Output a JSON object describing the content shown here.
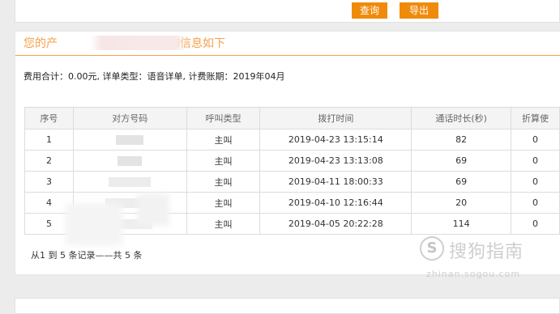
{
  "toolbar": {
    "query_label": "查询",
    "export_label": "导出"
  },
  "result": {
    "title_prefix": "您的产",
    "title_suffix": "询信息如下",
    "summary": "费用合计：0.00元, 详单类型：语音详单, 计费账期：2019年04月"
  },
  "table": {
    "columns": [
      "序号",
      "对方号码",
      "呼叫类型",
      "拨打时间",
      "通话时长(秒)",
      "折算使"
    ],
    "rows": [
      {
        "index": "1",
        "number": "",
        "type": "主叫",
        "time": "2019-04-23 13:15:14",
        "duration": "82",
        "converted": "0"
      },
      {
        "index": "2",
        "number": "",
        "type": "主叫",
        "time": "2019-04-23 13:13:08",
        "duration": "69",
        "converted": "0"
      },
      {
        "index": "3",
        "number": "",
        "type": "主叫",
        "time": "2019-04-11 18:00:33",
        "duration": "69",
        "converted": "0"
      },
      {
        "index": "4",
        "number": "",
        "type": "主叫",
        "time": "2019-04-10 12:16:44",
        "duration": "20",
        "converted": "0"
      },
      {
        "index": "5",
        "number": "",
        "type": "主叫",
        "time": "2019-04-05 20:22:28",
        "duration": "114",
        "converted": "0"
      }
    ]
  },
  "footer": {
    "count_text": "从1 到 5 条记录——共 5 条"
  },
  "watermark": {
    "logo_glyph": "S",
    "text": "搜狗指南",
    "url": "zhinan.sogou.com"
  },
  "colors": {
    "accent": "#f08a0a",
    "title": "#f5a04a"
  }
}
